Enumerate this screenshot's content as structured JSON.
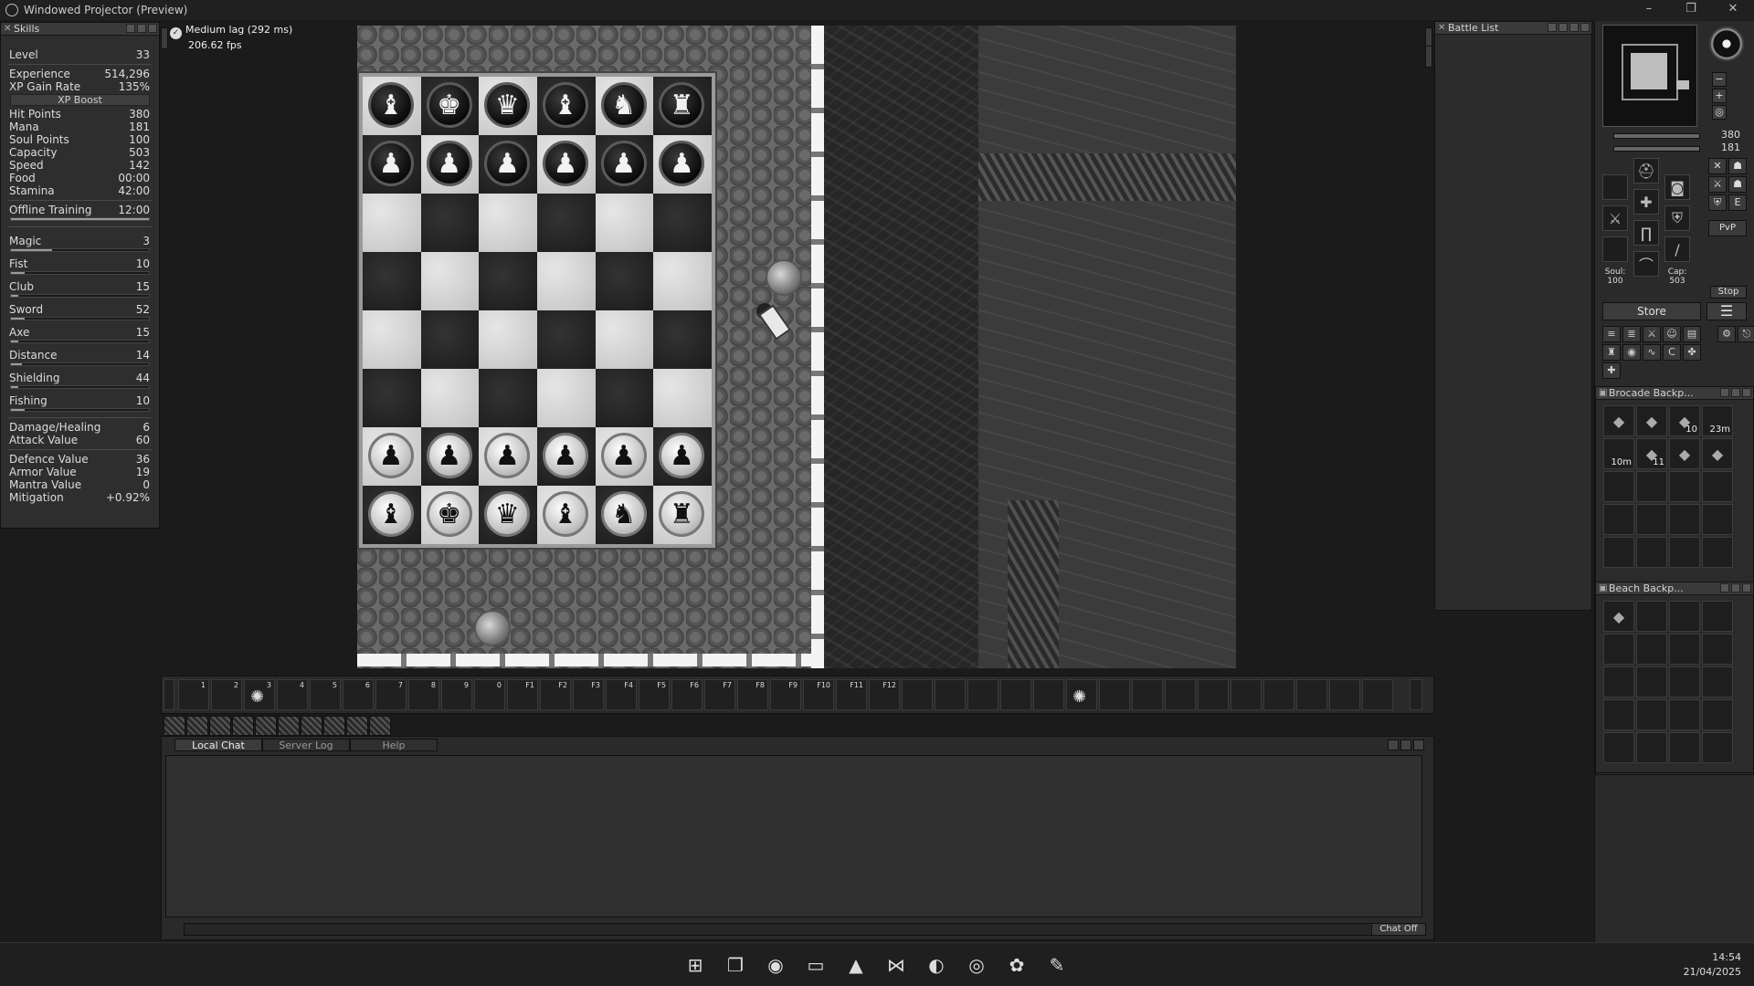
{
  "window": {
    "title": "Windowed Projector (Preview)"
  },
  "skills": {
    "title": "Skills",
    "rows1": [
      {
        "label": "Level",
        "value": "33"
      }
    ],
    "rows2": [
      {
        "label": "Experience",
        "value": "514,296"
      },
      {
        "label": "XP Gain Rate",
        "value": "135%"
      }
    ],
    "xp_boost": "XP Boost",
    "rows3": [
      {
        "label": "Hit Points",
        "value": "380"
      },
      {
        "label": "Mana",
        "value": "181"
      },
      {
        "label": "Soul Points",
        "value": "100"
      },
      {
        "label": "Capacity",
        "value": "503"
      },
      {
        "label": "Speed",
        "value": "142"
      },
      {
        "label": "Food",
        "value": "00:00"
      },
      {
        "label": "Stamina",
        "value": "42:00"
      }
    ],
    "offline": {
      "label": "Offline Training",
      "value": "12:00"
    },
    "bars": [
      {
        "label": "Magic",
        "value": "3",
        "progress": 0.3
      },
      {
        "label": "Fist",
        "value": "10",
        "progress": 0.1
      },
      {
        "label": "Club",
        "value": "15",
        "progress": 0.05
      },
      {
        "label": "Sword",
        "value": "52",
        "progress": 0.1
      },
      {
        "label": "Axe",
        "value": "15",
        "progress": 0.05
      },
      {
        "label": "Distance",
        "value": "14",
        "progress": 0.08
      },
      {
        "label": "Shielding",
        "value": "44",
        "progress": 0.05
      },
      {
        "label": "Fishing",
        "value": "10",
        "progress": 0.1
      }
    ],
    "rows4": [
      {
        "label": "Damage/Healing",
        "value": "6"
      },
      {
        "label": "Attack Value",
        "value": "60"
      }
    ],
    "rows5": [
      {
        "label": "Defence Value",
        "value": "36"
      },
      {
        "label": "Armor Value",
        "value": "19"
      },
      {
        "label": "Mantra Value",
        "value": "0"
      },
      {
        "label": "Mitigation",
        "value": "+0.92%"
      }
    ]
  },
  "status": {
    "lag": "Medium lag (292 ms)",
    "fps": "206.62 fps"
  },
  "chessboard": {
    "rows": [
      [
        "bl:bishop",
        "bl:king",
        "bl:queen",
        "bl:bishop",
        "bl:knight",
        "bl:rook"
      ],
      [
        "bl:pawn",
        "bl:pawn",
        "bl:pawn",
        "bl:pawn",
        "bl:pawn",
        "bl:pawn"
      ],
      [
        "",
        "",
        "",
        "",
        "",
        ""
      ],
      [
        "",
        "",
        "",
        "",
        "",
        ""
      ],
      [
        "",
        "",
        "",
        "",
        "",
        ""
      ],
      [
        "",
        "",
        "",
        "",
        "",
        ""
      ],
      [
        "wh:pawn",
        "wh:pawn",
        "wh:pawn",
        "wh:pawn",
        "wh:pawn",
        "wh:pawn"
      ],
      [
        "wh:bishop",
        "wh:king",
        "wh:queen",
        "wh:bishop",
        "wh:knight",
        "wh:rook"
      ]
    ]
  },
  "battle_list": {
    "title": "Battle List"
  },
  "vitals": {
    "hp": "380",
    "mana": "181",
    "soul_label": "Soul:",
    "soul": "100",
    "cap_label": "Cap:",
    "cap": "503",
    "stop": "Stop",
    "pvp": "PvP",
    "store": "Store"
  },
  "bags": [
    {
      "title": "Brocade Backp...",
      "items": [
        {
          "icon": "item",
          "count": ""
        },
        {
          "icon": "item",
          "count": ""
        },
        {
          "icon": "item",
          "count": "10"
        },
        {
          "icon": "",
          "count": "23m"
        },
        {
          "icon": "",
          "count": "10m"
        },
        {
          "icon": "item",
          "count": "11"
        },
        {
          "icon": "item",
          "count": ""
        },
        {
          "icon": "item",
          "count": ""
        }
      ]
    },
    {
      "title": "Beach Backp...",
      "items": [
        {
          "icon": "item",
          "count": ""
        }
      ]
    }
  ],
  "hotbar": {
    "keys": [
      "1",
      "2",
      "3",
      "4",
      "5",
      "6",
      "7",
      "8",
      "9",
      "0",
      "F1",
      "F2",
      "F3",
      "F4",
      "F5",
      "F6",
      "F7",
      "F8",
      "F9",
      "F10",
      "F11",
      "F12"
    ]
  },
  "chat": {
    "tabs": [
      "Local Chat",
      "Server Log",
      "Help"
    ],
    "chat_off": "Chat Off"
  },
  "taskbar": {
    "time": "14:54",
    "date": "21/04/2025"
  }
}
